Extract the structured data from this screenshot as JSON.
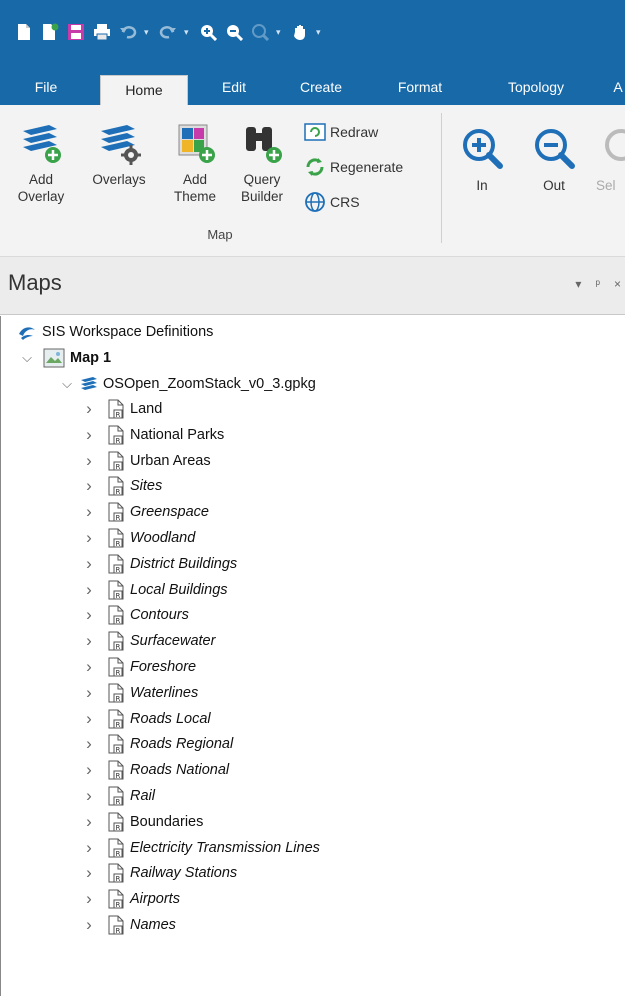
{
  "ribbon_tabs": [
    "File",
    "Home",
    "Edit",
    "Create",
    "Format",
    "Topology"
  ],
  "active_tab": "Home",
  "ribbon": {
    "add_overlay": [
      "Add",
      "Overlay"
    ],
    "overlays": "Overlays",
    "add_theme": [
      "Add",
      "Theme"
    ],
    "query_builder": [
      "Query",
      "Builder"
    ],
    "redraw": "Redraw",
    "regenerate": "Regenerate",
    "crs": "CRS",
    "map_group_label": "Map",
    "zoom_in": "In",
    "zoom_out": "Out",
    "select_partial": "Sel"
  },
  "panel": {
    "title": "Maps",
    "dropdown_icon": "▾",
    "pin_icon": "ᵖ",
    "close_icon": "×"
  },
  "tree": {
    "root": "SIS Workspace Definitions",
    "map": "Map 1",
    "dataset": "OSOpen_ZoomStack_v0_3.gpkg",
    "layers": [
      {
        "name": "Land",
        "italic": false
      },
      {
        "name": "National Parks",
        "italic": false
      },
      {
        "name": "Urban Areas",
        "italic": false
      },
      {
        "name": "Sites",
        "italic": true
      },
      {
        "name": "Greenspace",
        "italic": true
      },
      {
        "name": "Woodland",
        "italic": true
      },
      {
        "name": "District Buildings",
        "italic": true
      },
      {
        "name": "Local Buildings",
        "italic": true
      },
      {
        "name": "Contours",
        "italic": true
      },
      {
        "name": "Surfacewater",
        "italic": true
      },
      {
        "name": "Foreshore",
        "italic": true
      },
      {
        "name": "Waterlines",
        "italic": true
      },
      {
        "name": "Roads Local",
        "italic": true
      },
      {
        "name": "Roads Regional",
        "italic": true
      },
      {
        "name": "Roads National",
        "italic": true
      },
      {
        "name": "Rail",
        "italic": true
      },
      {
        "name": "Boundaries",
        "italic": false
      },
      {
        "name": "Electricity Transmission Lines",
        "italic": true
      },
      {
        "name": "Railway Stations",
        "italic": true
      },
      {
        "name": "Airports",
        "italic": true
      },
      {
        "name": "Names",
        "italic": true
      }
    ]
  },
  "colors": {
    "titlebar": "#1769a8",
    "ribbon": "#f3f3f3",
    "accent_green": "#3aa34a",
    "accent_blue": "#1e6fb7"
  }
}
